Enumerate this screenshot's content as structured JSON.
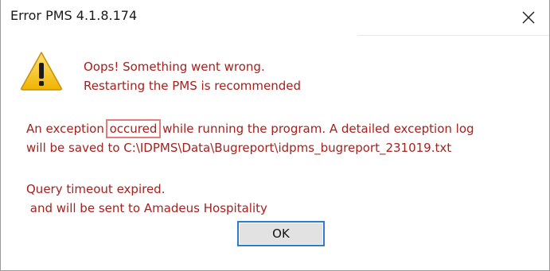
{
  "window": {
    "title": "Error PMS 4.1.8.174",
    "close_symbol": "✕"
  },
  "icons": {
    "warning": "warning-triangle-icon",
    "close": "close-icon"
  },
  "colors": {
    "message_text": "#a6211e",
    "highlight_box": "#e47c7c",
    "button_focus": "#2f7ad9",
    "warning_yellow": "#f4c20d"
  },
  "message": {
    "headline_line1": "Oops! Something went wrong.",
    "headline_line2": "Restarting the PMS is recommended",
    "detail_before": "An exception ",
    "detail_highlight": "occured",
    "detail_after": " while running the program. A detailed exception log",
    "detail_line2": "will be saved to C:\\IDPMS\\Data\\Bugreport\\idpms_bugreport_231019.txt",
    "query_line1": "Query timeout expired.",
    "query_line2": " and will be sent to Amadeus Hospitality"
  },
  "buttons": {
    "ok_label": "OK"
  }
}
